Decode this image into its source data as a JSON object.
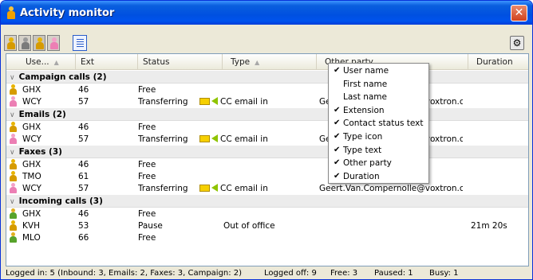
{
  "window": {
    "title": "Activity monitor",
    "close_label": "✕"
  },
  "toolbar": {
    "buttons": [
      "yellow-agent",
      "gray-agent",
      "yellow-agent-active",
      "pink-agent"
    ],
    "settings_glyph": "⚙"
  },
  "columns": [
    "Use...",
    "Ext",
    "Status",
    "Type",
    "Other party",
    "Duration"
  ],
  "groups": [
    {
      "label": "Campaign calls (2)",
      "rows": [
        {
          "icon": "yellow",
          "user": "GHX",
          "ext": "46",
          "status": "Free",
          "type": "",
          "other": "",
          "duration": ""
        },
        {
          "icon": "pink",
          "user": "WCY",
          "ext": "57",
          "status": "Transferring",
          "type": "CC email in",
          "other": "Geert.Van.Compernolle@voxtron.c...",
          "duration": ""
        }
      ]
    },
    {
      "label": "Emails (2)",
      "rows": [
        {
          "icon": "yellow",
          "user": "GHX",
          "ext": "46",
          "status": "Free",
          "type": "",
          "other": "",
          "duration": ""
        },
        {
          "icon": "pink",
          "user": "WCY",
          "ext": "57",
          "status": "Transferring",
          "type": "CC email in",
          "other": "Geert.Van.Compernolle@voxtron.c...",
          "duration": ""
        }
      ]
    },
    {
      "label": "Faxes (3)",
      "rows": [
        {
          "icon": "yellow",
          "user": "GHX",
          "ext": "46",
          "status": "Free",
          "type": "",
          "other": "",
          "duration": ""
        },
        {
          "icon": "yellow",
          "user": "TMO",
          "ext": "61",
          "status": "Free",
          "type": "",
          "other": "",
          "duration": ""
        },
        {
          "icon": "pink",
          "user": "WCY",
          "ext": "57",
          "status": "Transferring",
          "type": "CC email in",
          "other": "Geert.Van.Compernolle@voxtron.c...",
          "duration": ""
        }
      ]
    },
    {
      "label": "Incoming calls (3)",
      "rows": [
        {
          "icon": "green",
          "user": "GHX",
          "ext": "46",
          "status": "Free",
          "type": "",
          "other": "",
          "duration": ""
        },
        {
          "icon": "yellow",
          "user": "KVH",
          "ext": "53",
          "status": "Pause",
          "type": "Out of office",
          "other": "",
          "duration": "21m 20s"
        },
        {
          "icon": "green",
          "user": "MLO",
          "ext": "66",
          "status": "Free",
          "type": "",
          "other": "",
          "duration": ""
        }
      ]
    }
  ],
  "context_menu": [
    {
      "label": "User name",
      "checked": true
    },
    {
      "label": "First name",
      "checked": false
    },
    {
      "label": "Last name",
      "checked": false
    },
    {
      "label": "Extension",
      "checked": true
    },
    {
      "label": "Contact status text",
      "checked": true
    },
    {
      "label": "Type icon",
      "checked": true
    },
    {
      "label": "Type text",
      "checked": true
    },
    {
      "label": "Other party",
      "checked": true
    },
    {
      "label": "Duration",
      "checked": true
    }
  ],
  "statusbar": {
    "logged_in": "Logged in:  5 (Inbound: 3, Emails: 2, Faxes: 3, Campaign: 2)",
    "logged_off": "Logged off: 9",
    "free": "Free:  3",
    "paused": "Paused:  1",
    "busy": "Busy:  1"
  }
}
